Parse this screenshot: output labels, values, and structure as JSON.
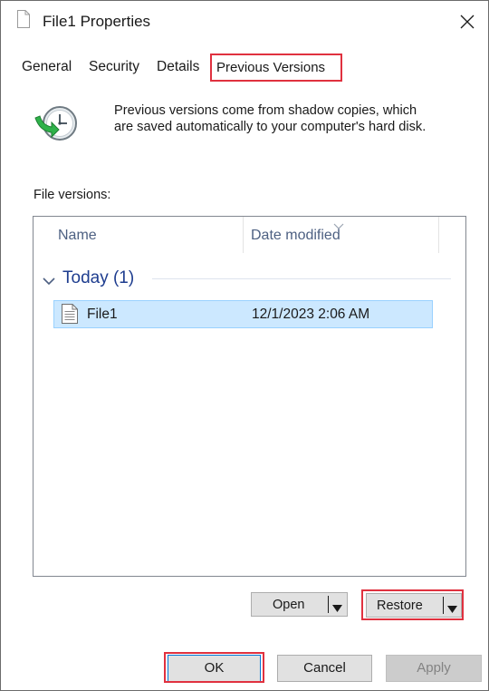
{
  "window": {
    "title": "File1 Properties"
  },
  "tabs": [
    {
      "label": "General"
    },
    {
      "label": "Security"
    },
    {
      "label": "Details"
    },
    {
      "label": "Previous Versions",
      "selected": true
    }
  ],
  "info": {
    "icon": "restore-clock-icon",
    "text_line1": "Previous versions come from shadow copies, which",
    "text_line2": "are saved automatically to your computer's hard disk."
  },
  "file_versions": {
    "label": "File versions:",
    "columns": [
      "Name",
      "Date modified"
    ],
    "groups": [
      {
        "label": "Today (1)",
        "items": [
          {
            "name": "File1",
            "date_modified": "12/1/2023 2:06 AM",
            "selected": true
          }
        ]
      }
    ]
  },
  "actions": {
    "open_label": "Open",
    "restore_label": "Restore"
  },
  "footer": {
    "ok_label": "OK",
    "cancel_label": "Cancel",
    "apply_label": "Apply",
    "apply_enabled": false
  },
  "colors": {
    "highlight_outline": "#e0313f",
    "selection_bg": "#cce8ff",
    "group_header": "#1e3d8f"
  }
}
